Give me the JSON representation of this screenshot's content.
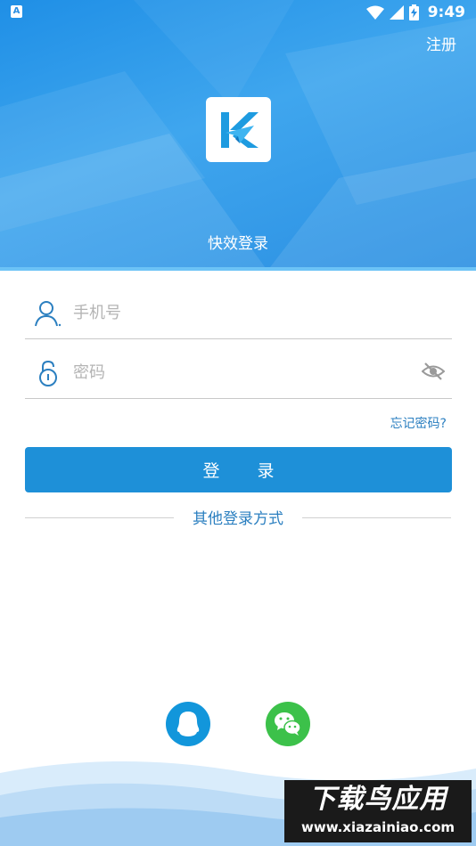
{
  "status_bar": {
    "app_icon_letter": "A",
    "time": "9:49"
  },
  "header": {
    "register_label": "注册",
    "title": "快效登录",
    "logo_icon": "k-paper-plane-logo"
  },
  "form": {
    "phone_placeholder": "手机号",
    "password_placeholder": "密码",
    "forgot_password_label": "忘记密码?",
    "login_button_label": "登 录"
  },
  "other_login": {
    "label": "其他登录方式",
    "options": [
      "qq-icon",
      "wechat-icon"
    ]
  },
  "watermark": {
    "title": "下载鸟应用",
    "url": "www.xiazainiao.com"
  },
  "colors": {
    "primary_blue": "#1e90d8",
    "header_blue": "#2b8fe2",
    "link_blue": "#2b7fc0",
    "qq_blue": "#1296db",
    "wechat_green": "#3cc14a"
  }
}
